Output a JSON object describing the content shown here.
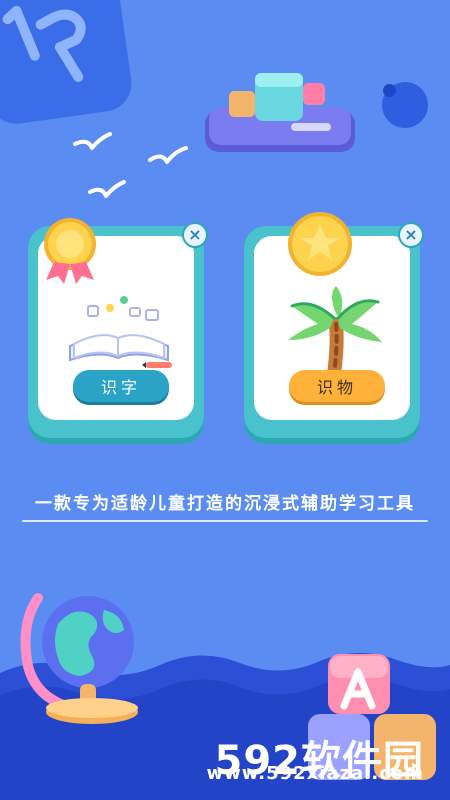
{
  "app": {
    "cards": [
      {
        "button_label": "识字"
      },
      {
        "button_label": "识物"
      }
    ],
    "tagline": "一款专为适龄儿童打造的沉浸式辅助学习工具",
    "watermark": {
      "title": "592软件园",
      "url": "www.592xiazai.com"
    }
  },
  "colors": {
    "background": "#5b8cf2",
    "card_border": "#49c2cc",
    "left_button": "#2ba3c7",
    "right_button": "#ffb23a"
  },
  "icons": [
    "badge-icon",
    "coin-icon",
    "close-icon",
    "book-icon",
    "palm-tree-icon",
    "globe-icon",
    "bird-icon",
    "phone-cubes-icon",
    "letter-blocks-icon"
  ]
}
